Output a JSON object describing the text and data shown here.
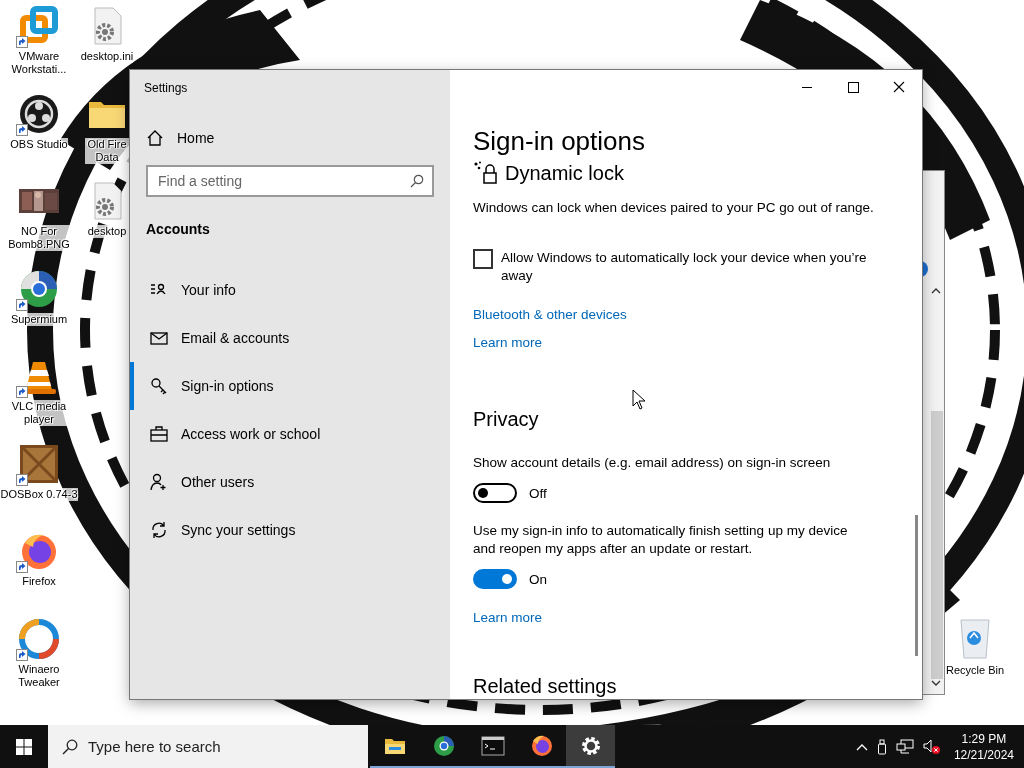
{
  "desktop": {
    "icons": [
      {
        "kind": "vmware",
        "label": "VMware Workstati..."
      },
      {
        "kind": "obs",
        "label": "OBS Studio"
      },
      {
        "label": "NO For Bomb8.PNG"
      },
      {
        "kind": "supermium",
        "label": "Supermium"
      },
      {
        "kind": "vlc",
        "label": "VLC media player"
      },
      {
        "kind": "dosbox",
        "label": "DOSBox 0.74-3"
      },
      {
        "kind": "firefox",
        "label": "Firefox"
      },
      {
        "kind": "winaero",
        "label": "Winaero Tweaker"
      },
      {
        "kind": "config",
        "label": "desktop.ini"
      },
      {
        "kind": "folder",
        "label": "Old Fire Data"
      },
      {
        "kind": "config",
        "label": "desktop"
      }
    ],
    "recycle_bin": {
      "label": "Recycle Bin"
    }
  },
  "settings": {
    "title": "Settings",
    "home": "Home",
    "search": {
      "placeholder": "Find a setting"
    },
    "section": "Accounts",
    "nav": [
      {
        "kind": "info",
        "label": "Your info",
        "selected": false
      },
      {
        "kind": "email",
        "label": "Email & accounts",
        "selected": false
      },
      {
        "kind": "key",
        "label": "Sign-in options",
        "selected": true
      },
      {
        "kind": "work",
        "label": "Access work or school",
        "selected": false
      },
      {
        "kind": "users",
        "label": "Other users",
        "selected": false
      },
      {
        "kind": "sync",
        "label": "Sync your settings",
        "selected": false
      }
    ],
    "page_title": "Sign-in options",
    "dynamic_lock": {
      "heading": "Dynamic lock",
      "description": "Windows can lock when devices paired to your PC go out of range.",
      "checkbox": {
        "label": "Allow Windows to automatically lock your device when you’re away",
        "checked": false
      },
      "links": [
        "Bluetooth & other devices",
        "Learn more"
      ]
    },
    "privacy": {
      "heading": "Privacy",
      "settings": [
        {
          "label": "Show account details (e.g. email address) on sign-in screen",
          "on": false,
          "state": "Off"
        },
        {
          "label": "Use my sign-in info to automatically finish setting up my device and reopen my apps after an update or restart.",
          "on": true,
          "state": "On"
        }
      ],
      "link": "Learn more"
    },
    "related_heading": "Related settings"
  },
  "taskbar": {
    "search": {
      "placeholder": "Type here to search"
    },
    "apps": [
      {
        "kind": "explorer",
        "selected": false
      },
      {
        "kind": "supermium",
        "selected": false
      },
      {
        "kind": "terminal",
        "selected": false
      },
      {
        "kind": "firefox",
        "selected": false
      },
      {
        "kind": "settings",
        "selected": true
      }
    ],
    "time": "1:29 PM",
    "date": "12/21/2024"
  }
}
